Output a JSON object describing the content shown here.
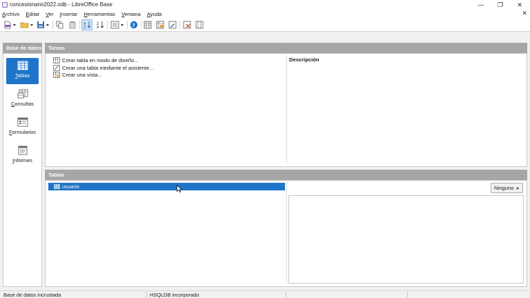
{
  "window": {
    "title": "concesionario2022.odb - LibreOffice Base",
    "controls": {
      "minimize": "—",
      "maximize": "❐",
      "close": "✕"
    },
    "doc_close": "✕"
  },
  "menu": [
    "Archivo",
    "Editar",
    "Ver",
    "Insertar",
    "Herramientas",
    "Ventana",
    "Ayuda"
  ],
  "toolbar": {
    "icons": [
      "new-document-icon",
      "open-folder-icon",
      "save-icon",
      "copy-icon",
      "paste-icon",
      "sort-ascending-icon",
      "sort-descending-icon",
      "view-options-icon",
      "help-icon",
      "table-icon",
      "query-icon",
      "edit-icon",
      "delete-icon",
      "table-properties-icon"
    ],
    "accent": "#1e74c8"
  },
  "database_panel": {
    "title": "Base de datos",
    "items": [
      {
        "label": "Tablas",
        "icon": "tables-icon",
        "selected": true
      },
      {
        "label": "Consultas",
        "icon": "queries-icon",
        "selected": false
      },
      {
        "label": "Formularios",
        "icon": "forms-icon",
        "selected": false
      },
      {
        "label": "Informes",
        "icon": "reports-icon",
        "selected": false
      }
    ]
  },
  "tasks_panel": {
    "title": "Tareas",
    "tasks": [
      "Crear tabla en modo de diseño...",
      "Crear una tabla mediante el asistente...",
      "Crear una vista..."
    ],
    "description_title": "Descripción"
  },
  "tables_panel": {
    "title": "Tablas",
    "rows": [
      {
        "name": "usuario",
        "selected": true
      }
    ],
    "preview_selector": {
      "selected": "Ninguno"
    }
  },
  "status_bar": {
    "left": "Base de datos incrustada",
    "middle": "HSQLDB incorporado"
  },
  "colors": {
    "header_gray": "#a6a6a6",
    "selection_blue": "#1e74c8"
  }
}
